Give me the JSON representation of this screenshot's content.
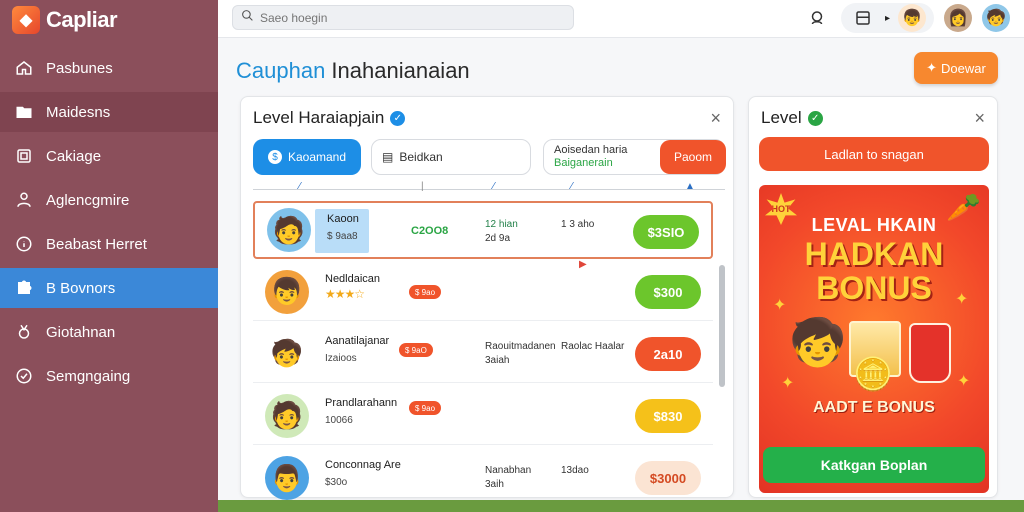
{
  "brand": {
    "name": "Capliar",
    "logo_glyph": "◆"
  },
  "sidebar": {
    "items": [
      {
        "label": "Pasbunes",
        "icon": "home-icon"
      },
      {
        "label": "Maidesns",
        "icon": "folder-icon"
      },
      {
        "label": "Cakiage",
        "icon": "box-icon"
      },
      {
        "label": "Aglencgmire",
        "icon": "person-icon"
      },
      {
        "label": "Beabast Herret",
        "icon": "info-icon"
      },
      {
        "label": "B Bovnors",
        "icon": "puzzle-icon"
      },
      {
        "label": "Giotahnan",
        "icon": "medal-icon"
      },
      {
        "label": "Semgngaing",
        "icon": "check-icon"
      }
    ]
  },
  "search": {
    "placeholder": "Saeo hoegin"
  },
  "page": {
    "title_first": "Cauphan",
    "title_rest": " Inahanianaian",
    "discover_label": "Doewar"
  },
  "main_panel": {
    "title": "Level Haraiapjain",
    "tabs": {
      "tab1": "Kaoamand",
      "tab2": "Beidkan",
      "tab3_line1": "Aoisedan haria",
      "tab3_line2": "Baiganerain",
      "tab3_button": "Paoom"
    },
    "rows": [
      {
        "name": "Kaoon",
        "sub": "$ 9aa8",
        "col1": "C2OO8",
        "col2a": "12 hian",
        "col2b": "2d 9a",
        "col3": "1 3 aho",
        "price": "$3SIO",
        "price_color": "#6cc62c"
      },
      {
        "name": "Nedldaican",
        "badge": "$ 9ao",
        "price": "$300",
        "price_color": "#6cc62c"
      },
      {
        "name": "Aanatilajanar",
        "sub": "Izaioos",
        "badge": "$ 9aO",
        "col2a": "Raouitmadanen",
        "col2b": "3aiah",
        "col3": "Raolac Haalar",
        "price": "2a10",
        "price_color": "#f0542b"
      },
      {
        "name": "Prandlarahann",
        "sub": "10066",
        "badge": "$ 9ao",
        "price": "$830",
        "price_color": "#f5c11a"
      },
      {
        "name": "Conconnag Are",
        "sub": "$30o",
        "col2a": "Nanabhan",
        "col2b": "3aih",
        "col3": "13dao",
        "price": "$3000",
        "price_color": "#fbe4d3",
        "price_text_color": "#d44a22"
      }
    ]
  },
  "side_panel": {
    "title": "Level",
    "button_label": "Ladlan to snagan",
    "promo": {
      "burst": "HOT",
      "line1": "LEVAL HKAIN",
      "line2a": "HADKAN",
      "line2b": "BONUS",
      "caption": "AADT E BONUS",
      "cta": "Katkgan Boplan"
    }
  },
  "colors": {
    "sidebar_bg": "#8b4f5b",
    "active_nav": "#3b88d8",
    "accent_orange": "#f7882f",
    "accent_blue": "#1d8ee6",
    "promo_red": "#f2482a",
    "cta_green": "#24b04a"
  }
}
